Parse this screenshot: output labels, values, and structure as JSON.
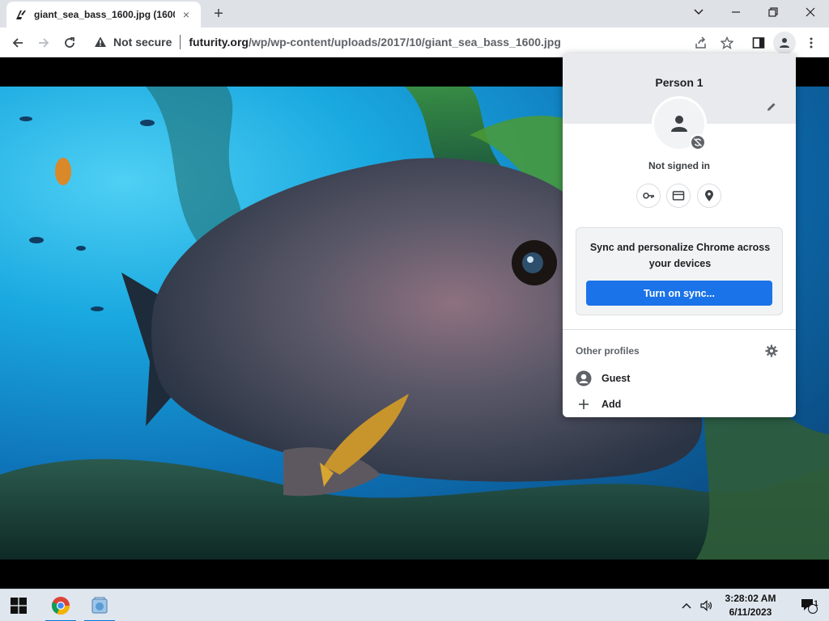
{
  "browser": {
    "tab": {
      "title": "giant_sea_bass_1600.jpg (1600×",
      "close": "×"
    },
    "new_tab": "+",
    "omnibox": {
      "security_label": "Not secure",
      "url_host": "futurity.org",
      "url_path": "/wp/wp-content/uploads/2017/10/giant_sea_bass_1600.jpg"
    }
  },
  "profile_menu": {
    "name": "Person 1",
    "status": "Not signed in",
    "sync_card_text": "Sync and personalize Chrome across your devices",
    "sync_button": "Turn on sync...",
    "other_profiles_title": "Other profiles",
    "profiles": [
      {
        "label": "Guest",
        "icon": "guest-avatar-icon"
      },
      {
        "label": "Add",
        "icon": "plus-icon"
      }
    ]
  },
  "taskbar": {
    "time": "3:28:02 AM",
    "date": "6/11/2023",
    "notification_count": "1"
  },
  "colors": {
    "accent": "#1a73e8",
    "tabstrip": "#dee1e6",
    "taskbar": "#dfe6ee"
  }
}
